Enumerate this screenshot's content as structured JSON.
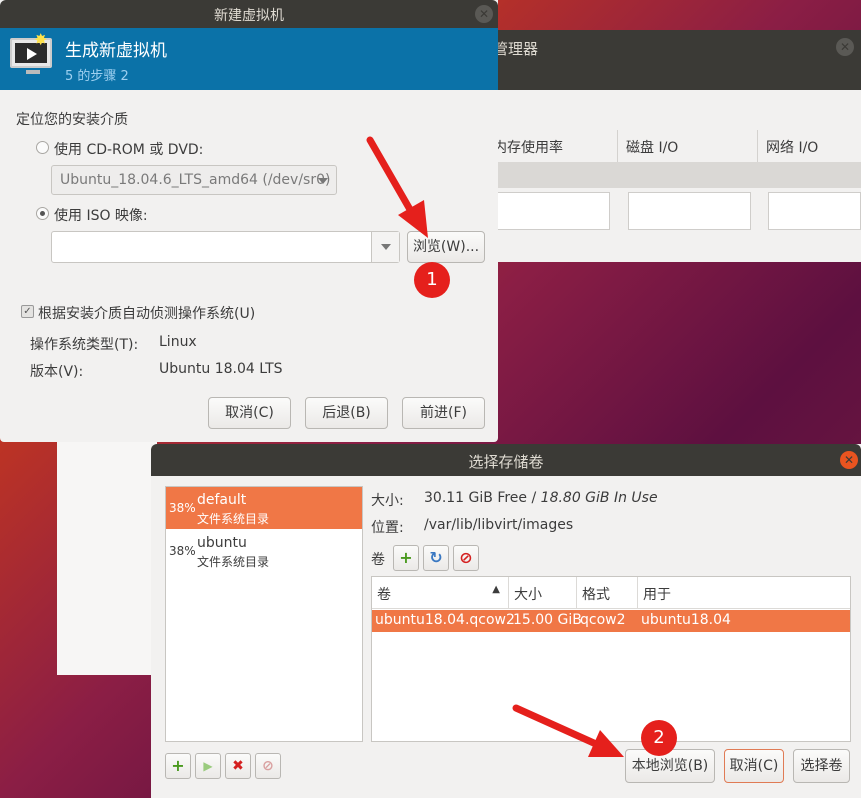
{
  "background_window": {
    "title_partial": "管理器",
    "columns": [
      "内存使用率",
      "磁盘 I/O",
      "网络 I/O"
    ]
  },
  "new_vm_dialog": {
    "title": "新建虚拟机",
    "banner_title": "生成新虚拟机",
    "banner_step": "5 的步骤 2",
    "section_label": "定位您的安装介质",
    "cdrom_label": "使用 CD-ROM 或 DVD:",
    "cdrom_value": "Ubuntu_18.04.6_LTS_amd64 (/dev/sr0)",
    "iso_label": "使用 ISO 映像:",
    "iso_value": "",
    "browse_button": "浏览(W)...",
    "auto_detect_label": "根据安装介质自动侦测操作系统(U)",
    "os_type_label": "操作系统类型(T):",
    "os_type_value": "Linux",
    "version_label": "版本(V):",
    "version_value": "Ubuntu 18.04 LTS",
    "cancel_button": "取消(C)",
    "back_button": "后退(B)",
    "forward_button": "前进(F)"
  },
  "storage_dialog": {
    "title": "选择存储卷",
    "pools": [
      {
        "percent": "38%",
        "name": "default",
        "desc": "文件系统目录",
        "selected": true
      },
      {
        "percent": "38%",
        "name": "ubuntu",
        "desc": "文件系统目录",
        "selected": false
      }
    ],
    "size_label": "大小:",
    "size_free": "30.11 GiB Free",
    "size_sep": "/",
    "size_in_use": "18.80 GiB In Use",
    "location_label": "位置:",
    "location_value": "/var/lib/libvirt/images",
    "volumes_label": "卷",
    "table_headers": [
      "卷",
      "大小",
      "格式",
      "用于"
    ],
    "volumes": [
      {
        "name": "ubuntu18.04.qcow2",
        "size": "15.00 GiB",
        "format": "qcow2",
        "used_by": "ubuntu18.04"
      }
    ],
    "browse_local_button": "本地浏览(B)",
    "cancel_button": "取消(C)",
    "choose_button": "选择卷"
  },
  "annotations": {
    "badge1": "1",
    "badge2": "2"
  },
  "colors": {
    "accent": "#f07746",
    "banner": "#0b72a8",
    "titlebar": "#3b3a36",
    "arrow": "#e5201c"
  }
}
